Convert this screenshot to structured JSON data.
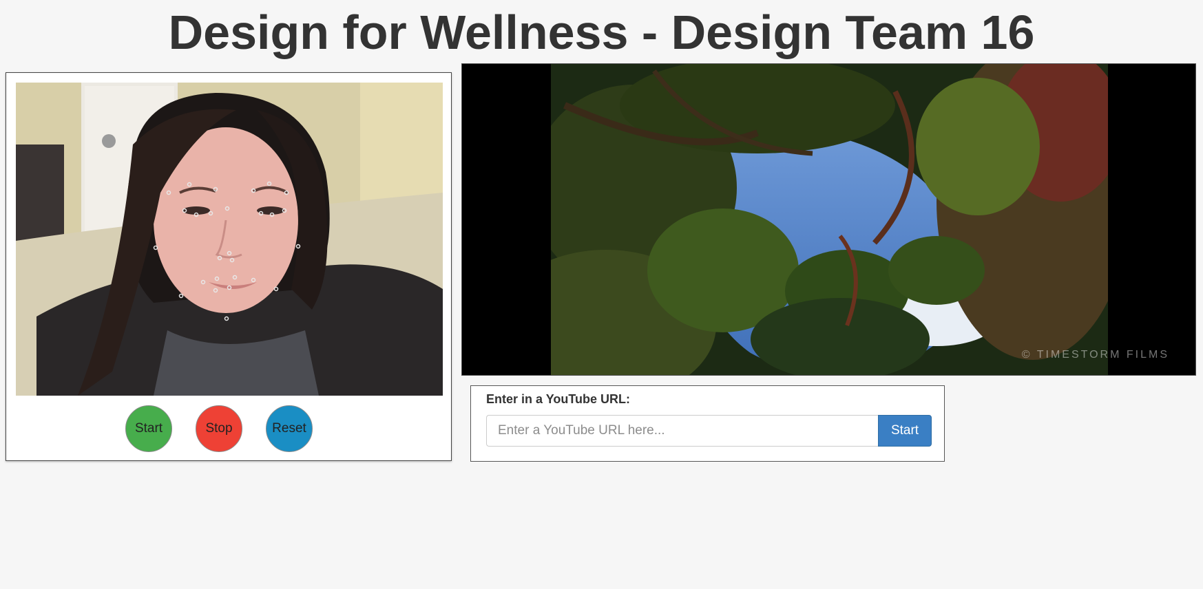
{
  "page": {
    "title": "Design for Wellness - Design Team 16"
  },
  "webcam": {
    "feed_description": "webcam-feed",
    "controls": {
      "start_label": "Start",
      "stop_label": "Stop",
      "reset_label": "Reset"
    },
    "colors": {
      "start": "#47ad4c",
      "stop": "#ee4135",
      "reset": "#1a8ec4"
    }
  },
  "video": {
    "watermark": "© TIMESTORM FILMS"
  },
  "url_form": {
    "label": "Enter in a YouTube URL:",
    "input_value": "",
    "input_placeholder": "Enter a YouTube URL here...",
    "submit_label": "Start",
    "submit_color": "#3a7fc4"
  }
}
